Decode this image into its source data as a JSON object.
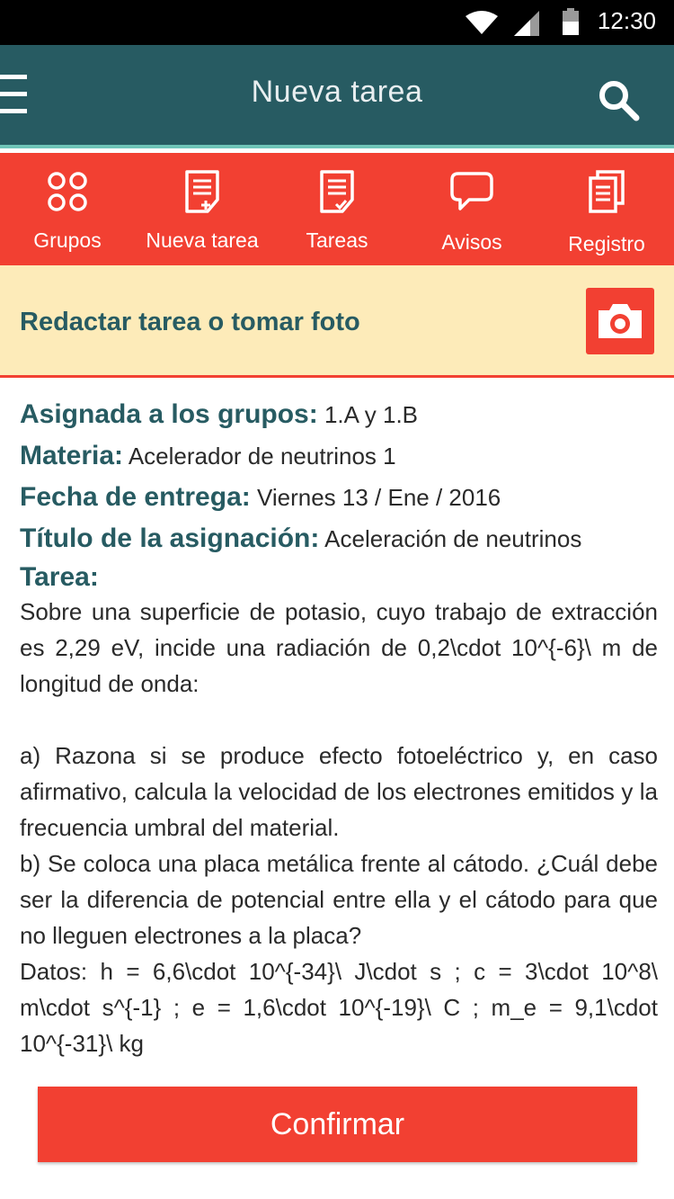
{
  "status_bar": {
    "time": "12:30"
  },
  "app_bar": {
    "title": "Nueva tarea"
  },
  "nav": {
    "items": [
      {
        "label": "Grupos",
        "icon": "groups-icon"
      },
      {
        "label": "Nueva tarea",
        "icon": "new-task-icon"
      },
      {
        "label": "Tareas",
        "icon": "tasks-icon"
      },
      {
        "label": "Avisos",
        "icon": "chat-icon"
      },
      {
        "label": "Registro",
        "icon": "log-icon"
      }
    ]
  },
  "compose": {
    "title": "Redactar tarea o tomar foto",
    "icon": "camera-icon"
  },
  "details": {
    "groups_key": "Asignada a los grupos:",
    "groups_value": "1.A y 1.B",
    "subject_key": "Materia:",
    "subject_value": "Acelerador de neutrinos 1",
    "due_key": "Fecha de entrega:",
    "due_value": "Viernes 13 / Ene / 2016",
    "title_key": "Título de la asignación:",
    "title_value": "Aceleración de neutrinos",
    "task_key": "Tarea:",
    "task_body": "Sobre una superficie de potasio, cuyo trabajo de extracción es 2,29 eV, incide una radiación de 0,2\\c­dot 10^{-6}\\ m de longitud de onda:\n\na) Razona si se produce efecto fotoeléctrico y, en caso afirmativo, calcula la velocidad de los electrones emitidos y la frecuencia umbral del material.\nb) Se coloca una placa metálica frente al cátodo. ¿Cuál debe ser la diferencia de potencial entre ella y el cátodo para que no lleguen electrones a la placa?\nDatos: h = 6,6\\cdot 10^{-34}\\ J\\cdot s ; c = 3\\cdot 10^8\\ m\\cdot s^{-1} ; e = 1,6\\cdot 10^{-19}\\ C ; m_e = 9,1\\cdot 10^{-31}\\ kg"
  },
  "confirm": {
    "label": "Confirmar"
  },
  "colors": {
    "app_bar": "#275b62",
    "accent_red": "#f24032",
    "banner": "#fdebb9",
    "teal_text": "#275b62"
  }
}
